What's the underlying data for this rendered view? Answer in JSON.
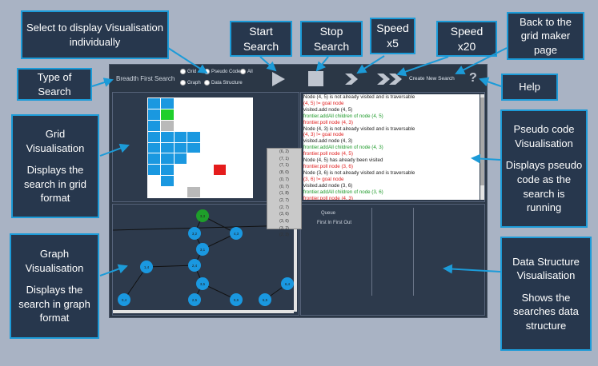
{
  "app": {
    "algorithm_title": "Breadth First Search",
    "radio_grid": "Grid",
    "radio_graph": "Graph",
    "radio_pseudo": "Pseudo Code",
    "radio_datastructure": "Data Structure",
    "radio_all": "All",
    "create_new_search": "Create New Search",
    "help_symbol": "?",
    "queue_label": "Queue",
    "queue_type": "First In First Out",
    "queue_items": [
      "(6, 2)",
      "(7, 1)",
      "(7, 1)",
      "(8, 0)",
      "(0, 7)",
      "(0, 7)",
      "(1, 8)",
      "(2, 7)",
      "(2, 7)",
      "(3, 6)",
      "(3, 6)",
      "(3, 2)",
      "(2, 3)"
    ],
    "pseudo_lines": [
      {
        "text": "Node (4, 5) is not already visited and is traversable",
        "color": "black"
      },
      {
        "text": "(4, 5) != goal node",
        "color": "red"
      },
      {
        "text": "visited.add node (4, 5)",
        "color": "black"
      },
      {
        "text": "frontier.addAll children of node (4, 5)",
        "color": "green"
      },
      {
        "text": "frontier.poll node (4, 3)",
        "color": "red"
      },
      {
        "text": "Node (4, 3) is not already visited and is traversable",
        "color": "black"
      },
      {
        "text": "(4, 3) != goal node",
        "color": "red"
      },
      {
        "text": "visited.add node (4, 3)",
        "color": "black"
      },
      {
        "text": "frontier.addAll children of node (4, 3)",
        "color": "green"
      },
      {
        "text": "frontier.poll node (4, 5)",
        "color": "red"
      },
      {
        "text": "Node (4, 5) has already been visited",
        "color": "black"
      },
      {
        "text": "frontier.poll node (3, 6)",
        "color": "red"
      },
      {
        "text": "Node (3, 6) is not already visited and is traversable",
        "color": "black"
      },
      {
        "text": "(3, 6) != goal node",
        "color": "red"
      },
      {
        "text": "visited.add node (3, 6)",
        "color": "black"
      },
      {
        "text": "frontier.addAll children of node (3, 6)",
        "color": "green"
      },
      {
        "text": "frontier.poll node (4, 3)",
        "color": "red"
      }
    ],
    "graph_nodes": [
      {
        "label": "3,3",
        "color": "#1e9e2a"
      },
      {
        "label": "3,2",
        "color": "#1a98e0"
      },
      {
        "label": "4,3",
        "color": "#1a98e0"
      },
      {
        "label": "3,1",
        "color": "#1a98e0"
      },
      {
        "label": "2,4",
        "color": "#1a98e0"
      },
      {
        "label": "1,4",
        "color": "#1a98e0"
      },
      {
        "label": "3,5",
        "color": "#1a98e0"
      },
      {
        "label": "6,4",
        "color": "#1a98e0"
      },
      {
        "label": "0,4",
        "color": "#1a98e0"
      },
      {
        "label": "2,5",
        "color": "#1a98e0"
      },
      {
        "label": "5,6",
        "color": "#1a98e0"
      },
      {
        "label": "6,5",
        "color": "#1a98e0"
      }
    ]
  },
  "callouts": {
    "select": [
      "Select to display Visualisation",
      "individually"
    ],
    "start": [
      "Start",
      "Search"
    ],
    "stop": [
      "Stop",
      "Search"
    ],
    "speed5": [
      "Speed",
      "x5"
    ],
    "speed20": [
      "Speed",
      "x20"
    ],
    "back": [
      "Back to the",
      "grid maker",
      "page"
    ],
    "type": [
      "Type of",
      "Search"
    ],
    "help": [
      "Help"
    ],
    "grid": [
      "Grid",
      "Visualisation",
      "Displays the",
      "search in grid",
      "format"
    ],
    "pseudo": [
      "Pseudo code",
      "Visualisation",
      "Displays pseudo",
      "code as the",
      "search is",
      "running"
    ],
    "graph": [
      "Graph",
      "Visualisation",
      "Displays the",
      "search in graph",
      "format"
    ],
    "ds": [
      "Data Structure",
      "Visualisation",
      "Shows the",
      "searches data",
      "structure"
    ]
  }
}
